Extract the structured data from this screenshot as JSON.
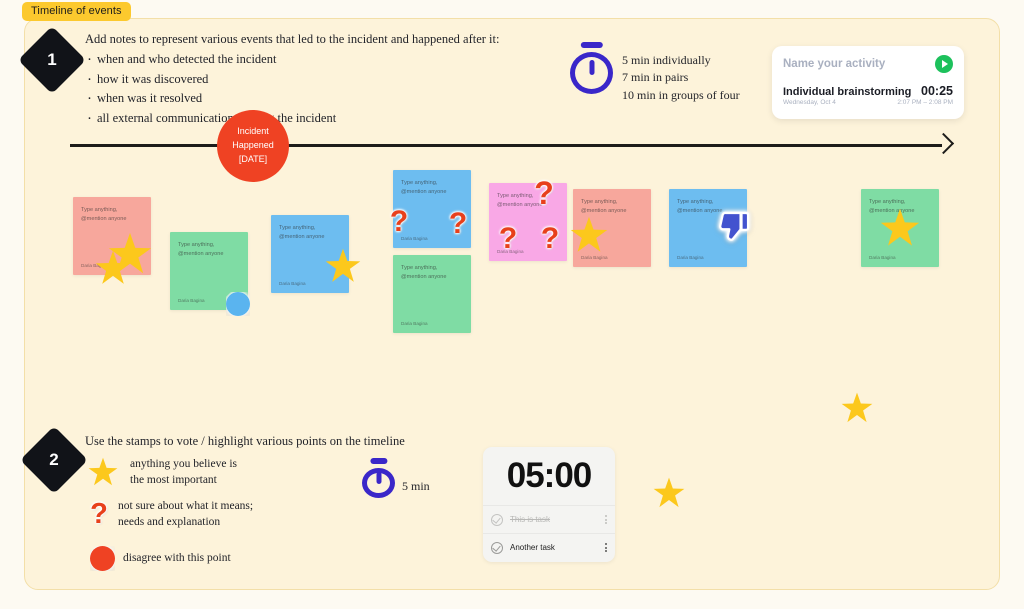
{
  "tag": {
    "label": "Timeline of events"
  },
  "steps": [
    {
      "number": "1",
      "lead": "Add notes to represent various events that led to the incident and happened after it:",
      "bullets": [
        "when and who detected the incident",
        "how it was discovered",
        "when was it resolved",
        "all external communications during the incident"
      ]
    },
    {
      "number": "2",
      "lead": "Use the stamps to vote / highlight various points on the timeline",
      "bullets": []
    }
  ],
  "timeline": {
    "incident": {
      "line1": "Incident",
      "line2": "Happened",
      "line3": "[DATE]"
    }
  },
  "timing": {
    "top": {
      "line1": "5 min individually",
      "line2": "7 min in pairs",
      "line3": "10 min in groups of four"
    },
    "bottom": {
      "label": "5 min"
    }
  },
  "activity_card": {
    "placeholder": "Name your activity",
    "title": "Individual brainstorming",
    "duration": "00:25",
    "date": "Wednesday, Oct 4",
    "range": "2:07 PM – 2:08 PM",
    "play_icon": "play-icon",
    "accent": "#1dc15c"
  },
  "notes": [
    {
      "id": "n1",
      "color": "#f7a79c",
      "placeholder": "Type anything, @mention anyone",
      "author": "Daria Bagina"
    },
    {
      "id": "n2",
      "color": "#7fdca4",
      "placeholder": "Type anything, @mention anyone",
      "author": "Daria Bagina"
    },
    {
      "id": "n3",
      "color": "#6dbdf0",
      "placeholder": "Type anything, @mention anyone",
      "author": "Daria Bagina"
    },
    {
      "id": "n4",
      "color": "#6dbdf0",
      "placeholder": "Type anything, @mention anyone",
      "author": "Daria Bagina"
    },
    {
      "id": "n5",
      "color": "#7fdca4",
      "placeholder": "Type anything, @mention anyone",
      "author": "Daria Bagina"
    },
    {
      "id": "n6",
      "color": "#f9a8e6",
      "placeholder": "Type anything, @mention anyone",
      "author": "Daria Bagina"
    },
    {
      "id": "n7",
      "color": "#f7a79c",
      "placeholder": "Type anything, @mention anyone",
      "author": "Daria Bagina"
    },
    {
      "id": "n8",
      "color": "#6dbdf0",
      "placeholder": "Type anything, @mention anyone",
      "author": "Daria Bagina"
    },
    {
      "id": "n9",
      "color": "#7fdca4",
      "placeholder": "Type anything, @mention anyone",
      "author": "Daria Bagina"
    }
  ],
  "legend": [
    {
      "icon": "star-stamp",
      "line1": "anything you believe is",
      "line2": "the most important"
    },
    {
      "icon": "question-mark-stamp",
      "line1": "not sure about what it means;",
      "line2": "needs and explanation"
    },
    {
      "icon": "disagree-blob-stamp",
      "line1": "disagree with this point",
      "line2": ""
    }
  ],
  "timer_widget": {
    "display": "05:00",
    "tasks": [
      {
        "label": "This is task",
        "done": true
      },
      {
        "label": "Another task",
        "done": false
      }
    ]
  },
  "colors": {
    "board_bg": "#fdf3da",
    "page_bg": "#fdfaf2",
    "accent_yellow": "#fcc92e",
    "incident_red": "#ef4223",
    "stamp_star": "#fcc81c",
    "stamp_question": "#e8401b",
    "indigo": "#3a27c9",
    "thumb_blue": "#4353cf"
  }
}
